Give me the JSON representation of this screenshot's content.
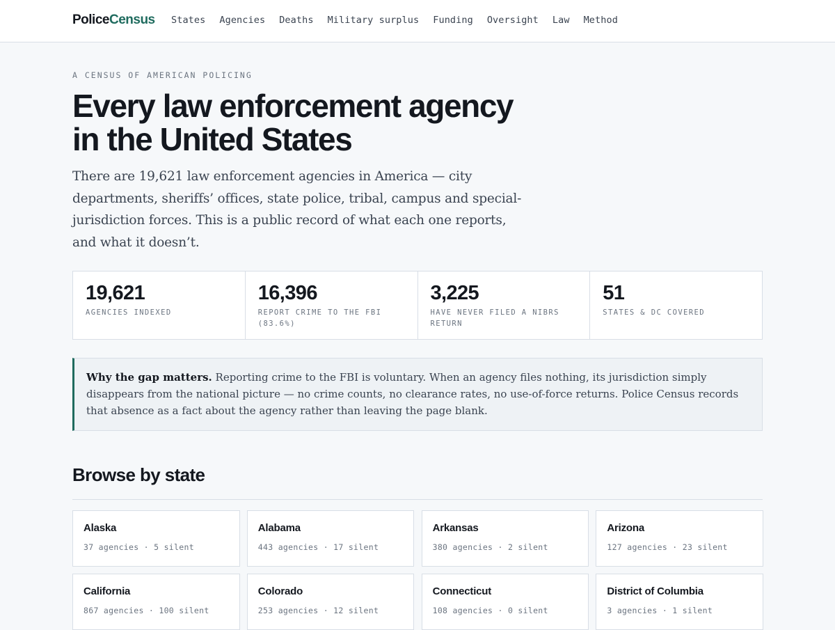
{
  "brand": {
    "part1": "Police",
    "part2": "Census"
  },
  "nav": [
    "States",
    "Agencies",
    "Deaths",
    "Military surplus",
    "Funding",
    "Oversight",
    "Law",
    "Method"
  ],
  "hero": {
    "kicker": "A CENSUS OF AMERICAN POLICING",
    "title": "Every law enforcement agency in the United States",
    "lede": "There are 19,621 law enforcement agencies in America — city departments, sheriffs’ offices, state police, tribal, campus and special-jurisdiction forces. This is a public record of what each one reports, and what it doesn’t."
  },
  "stats": [
    {
      "value": "19,621",
      "label": "AGENCIES INDEXED"
    },
    {
      "value": "16,396",
      "label": "REPORT CRIME TO THE FBI (83.6%)"
    },
    {
      "value": "3,225",
      "label": "HAVE NEVER FILED A NIBRS RETURN"
    },
    {
      "value": "51",
      "label": "STATES & DC COVERED"
    }
  ],
  "callout": {
    "lead": "Why the gap matters.",
    "body": " Reporting crime to the FBI is voluntary. When an agency files nothing, its jurisdiction simply disappears from the national picture — no crime counts, no clearance rates, no use-of-force returns. Police Census records that absence as a fact about the agency rather than leaving the page blank."
  },
  "browse": {
    "title": "Browse by state",
    "states": [
      {
        "name": "Alaska",
        "meta": "37 agencies · 5 silent"
      },
      {
        "name": "Alabama",
        "meta": "443 agencies · 17 silent"
      },
      {
        "name": "Arkansas",
        "meta": "380 agencies · 2 silent"
      },
      {
        "name": "Arizona",
        "meta": "127 agencies · 23 silent"
      },
      {
        "name": "California",
        "meta": "867 agencies · 100 silent"
      },
      {
        "name": "Colorado",
        "meta": "253 agencies · 12 silent"
      },
      {
        "name": "Connecticut",
        "meta": "108 agencies · 0 silent"
      },
      {
        "name": "District of Columbia",
        "meta": "3 agencies · 1 silent"
      }
    ]
  },
  "colors": {
    "accent": "#1f6b5e",
    "text": "#14181f",
    "muted": "#6b7480",
    "border": "#d8dee6",
    "background": "#f6f8fa"
  }
}
